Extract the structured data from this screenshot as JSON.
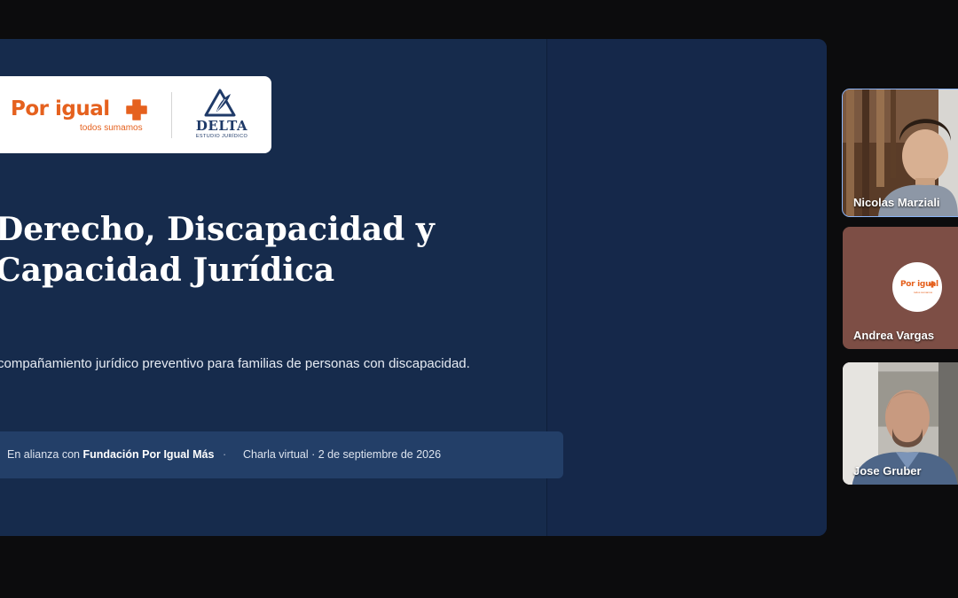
{
  "slide": {
    "logos": {
      "porigual": {
        "name": "Por igual",
        "tagline": "todos sumamos",
        "color": "#e5611e"
      },
      "delta": {
        "name": "DELTA",
        "subtitle": "ESTUDIO JURÍDICO",
        "color": "#1f3a68"
      }
    },
    "title_line1": "Derecho, Discapacidad y",
    "title_line2": "Capacidad Jurídica",
    "subtitle": "compañamiento jurídico preventivo para familias de personas con discapacidad.",
    "alliance": {
      "prefix": "En alianza con ",
      "organization": "Fundación Por Igual Más",
      "separator": "·",
      "event": "Charla virtual · 2 de septiembre de 2026"
    },
    "colors": {
      "background": "#162b4c",
      "bar": "#233f68",
      "accent": "#e5611e"
    }
  },
  "participants": [
    {
      "name": "Nicolas Marziali",
      "active_speaker": true,
      "video": true
    },
    {
      "name": "Andrea Vargas",
      "video": false,
      "avatar": {
        "name": "Por igual",
        "tagline": "todos sumamos"
      }
    },
    {
      "name": "Jose Gruber",
      "video": true
    }
  ]
}
